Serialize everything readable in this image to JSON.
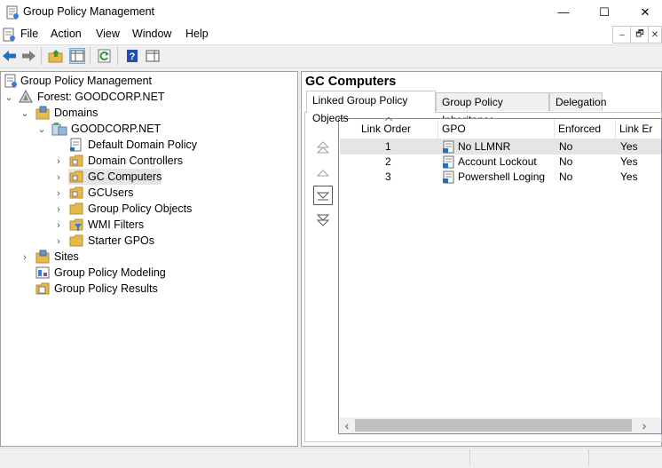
{
  "window": {
    "title": "Group Policy Management",
    "minimize_glyph": "—",
    "maximize_glyph": "☐",
    "close_glyph": "✕"
  },
  "menu": [
    "File",
    "Action",
    "View",
    "Window",
    "Help"
  ],
  "mdi": {
    "minimize": "–",
    "restore": "🗗",
    "close": "✕"
  },
  "tree": {
    "root": "Group Policy Management",
    "forest": "Forest: GOODCORP.NET",
    "domains": "Domains",
    "domain": "GOODCORP.NET",
    "children": [
      "Default Domain Policy",
      "Domain Controllers",
      "GC Computers",
      "GCUsers",
      "Group Policy Objects",
      "WMI Filters",
      "Starter GPOs"
    ],
    "selected": "GC Computers",
    "sites": "Sites",
    "modeling": "Group Policy Modeling",
    "results": "Group Policy Results"
  },
  "detail": {
    "heading": "GC Computers",
    "tabs": [
      "Linked Group Policy Objects",
      "Group Policy Inheritance",
      "Delegation"
    ],
    "active_tab": "Linked Group Policy Objects",
    "columns": [
      "Link Order",
      "GPO",
      "Enforced",
      "Link Er"
    ],
    "rows": [
      {
        "order": "1",
        "gpo": "No LLMNR",
        "enforced": "No",
        "link_enabled": "Yes"
      },
      {
        "order": "2",
        "gpo": "Account Lockout",
        "enforced": "No",
        "link_enabled": "Yes"
      },
      {
        "order": "3",
        "gpo": "Powershell Loging",
        "enforced": "No",
        "link_enabled": "Yes"
      }
    ],
    "scroll_left": "‹",
    "scroll_right": "›"
  },
  "colors": {
    "selection": "#e5e5e5",
    "accent_arrow": "#1f6fc5",
    "folder": "#e6b94d"
  }
}
